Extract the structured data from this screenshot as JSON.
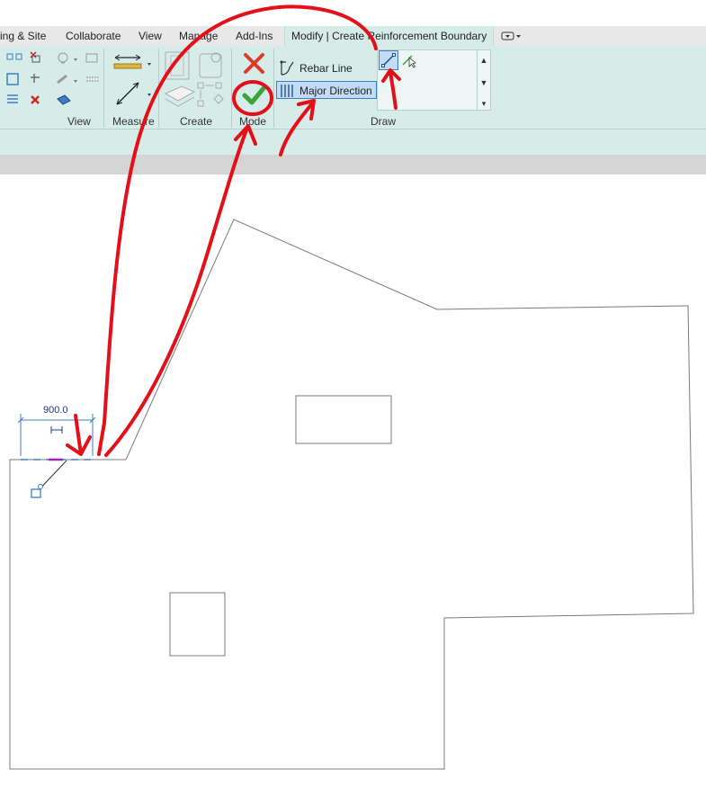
{
  "ribbon": {
    "tabs": [
      {
        "label": "ing & Site"
      },
      {
        "label": "Collaborate"
      },
      {
        "label": "View"
      },
      {
        "label": "Manage"
      },
      {
        "label": "Add-Ins"
      },
      {
        "label": "Modify | Create Reinforcement Boundary"
      }
    ],
    "panels": {
      "view": "View",
      "measure": "Measure",
      "create": "Create",
      "mode": "Mode",
      "draw": "Draw"
    },
    "draw": {
      "rebar_line": "Rebar Line",
      "major_direction": "Major Direction"
    }
  },
  "canvas": {
    "dimension_value": "900.0"
  },
  "colors": {
    "ribbon_bg": "#d5ece9",
    "selection": "#3c7fc4",
    "annotation": "#e3101a",
    "finish_green": "#3aa33a",
    "cancel_red": "#e03a2a"
  },
  "icons": [
    "cancel-edit-mode-icon",
    "finish-edit-mode-icon",
    "rebar-line-icon",
    "major-direction-icon",
    "line-draw-icon",
    "pick-lines-icon"
  ]
}
